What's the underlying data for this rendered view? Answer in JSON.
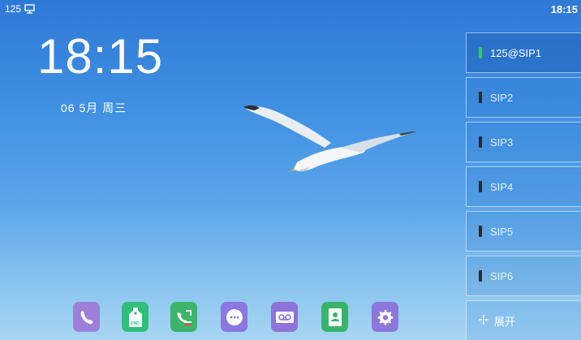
{
  "status_bar": {
    "extension": "125",
    "network_icon": "network-icon",
    "time": "18:15"
  },
  "clock": {
    "time": "18:15",
    "date": "06 5月 周三"
  },
  "line_keys": [
    {
      "label": "125@SIP1",
      "led": "green"
    },
    {
      "label": "SIP2",
      "led": "off"
    },
    {
      "label": "SIP3",
      "led": "off"
    },
    {
      "label": "SIP4",
      "led": "off"
    },
    {
      "label": "SIP5",
      "led": "off"
    },
    {
      "label": "SIP6",
      "led": "off"
    }
  ],
  "expand": {
    "label": "展开",
    "icon": "expand-icon"
  },
  "dock": {
    "apps": [
      {
        "icon": "phone-icon",
        "color": "#9b7fd9"
      },
      {
        "icon": "dnd-icon",
        "color": "#2fbf7a"
      },
      {
        "icon": "call-forward-icon",
        "color": "#3cb46a"
      },
      {
        "icon": "menu-icon",
        "color": "#8a77e0"
      },
      {
        "icon": "voicemail-icon",
        "color": "#8e73d8"
      },
      {
        "icon": "directory-icon",
        "color": "#37b46a"
      },
      {
        "icon": "settings-icon",
        "color": "#8c78dd"
      }
    ],
    "dnd_text": "DND"
  },
  "colors": {
    "led_green": "#35d046",
    "led_off": "#2a2a2a"
  }
}
